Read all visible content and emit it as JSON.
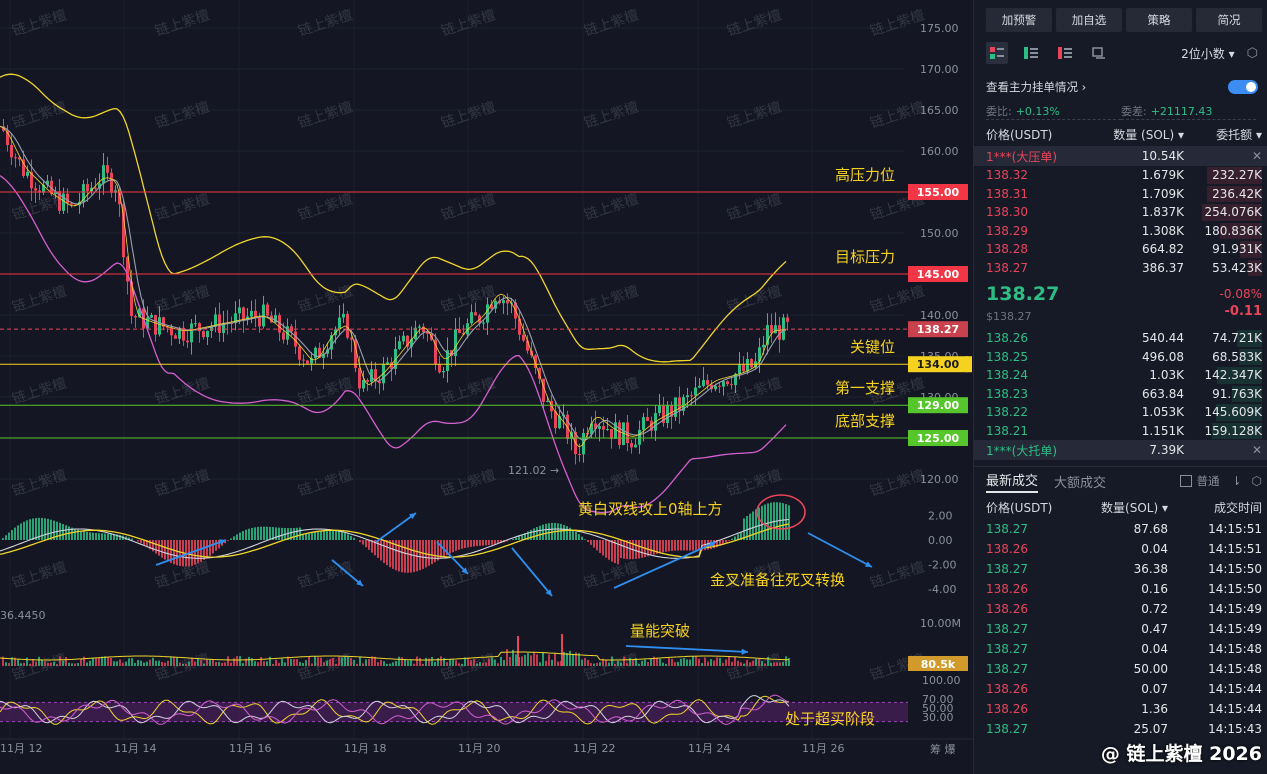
{
  "chart": {
    "price_axis": [
      "175.00",
      "170.00",
      "165.00",
      "160.00",
      "155.00",
      "150.00",
      "145.00",
      "140.00",
      "135.00",
      "130.00",
      "125.00",
      "120.00"
    ],
    "macd_axis": [
      "2.00",
      "0.00",
      "-2.00",
      "-4.00"
    ],
    "volume_axis": [
      "10.00M"
    ],
    "rsi_axis": [
      "100.00",
      "70.00",
      "50.00",
      "30.00"
    ],
    "date_axis": [
      "11月 12",
      "11月 14",
      "11月 16",
      "11月 18",
      "11月 20",
      "11月 22",
      "11月 24",
      "11月 26"
    ],
    "corner_right": "筹 爆",
    "levels": [
      {
        "label": "高压力位",
        "value": "155.00",
        "price": 155,
        "color": "#f23645",
        "text": "#ffffff"
      },
      {
        "label": "目标压力",
        "value": "145.00",
        "price": 145,
        "color": "#f23645",
        "text": "#ffffff"
      },
      {
        "label": "关键位",
        "value": "134.00",
        "price": 134,
        "color": "#f5d21f",
        "text": "#1a1a1a"
      },
      {
        "label": "第一支撑",
        "value": "129.00",
        "price": 129,
        "color": "#57c52c",
        "text": "#ffffff"
      },
      {
        "label": "底部支撑",
        "value": "125.00",
        "price": 125,
        "color": "#57c52c",
        "text": "#ffffff"
      }
    ],
    "current_price_tag": "138.27",
    "low_marker": "121.02 →",
    "macd_left_value": "36.4450",
    "volume_tag": "80.5k",
    "annotations": {
      "macd": "黄白双线攻上0轴上方",
      "cross": "金叉准备往死叉转换",
      "volume": "量能突破",
      "rsi": "处于超买阶段"
    },
    "watermark": "链上紫檀",
    "colors": {
      "up": "#2ebd85",
      "down": "#e8455a",
      "ma_yellow": "#f5d21f",
      "boll": "#d35fd0",
      "arrow": "#2f8ff0"
    }
  },
  "side": {
    "buttons": [
      "加预警",
      "加自选",
      "策略",
      "简况"
    ],
    "precision": "2位小数",
    "main_orders": "查看主力挂单情况",
    "ratio_label": "委比:",
    "ratio_value": "+0.13%",
    "diff_label": "委差:",
    "diff_value": "+21117.43",
    "ob_headers": [
      "价格(USDT)",
      "数量 (SOL)",
      "委托额"
    ],
    "big_ask": {
      "label": "1***(大压单)",
      "qty": "10.54K"
    },
    "asks": [
      {
        "p": "138.32",
        "q": "1.679K",
        "a": "232.27K",
        "d": 0.55
      },
      {
        "p": "138.31",
        "q": "1.709K",
        "a": "236.42K",
        "d": 0.55
      },
      {
        "p": "138.30",
        "q": "1.837K",
        "a": "254.076K",
        "d": 0.6
      },
      {
        "p": "138.29",
        "q": "1.308K",
        "a": "180.836K",
        "d": 0.42
      },
      {
        "p": "138.28",
        "q": "664.82",
        "a": "91.931K",
        "d": 0.22
      },
      {
        "p": "138.27",
        "q": "386.37",
        "a": "53.423K",
        "d": 0.14
      }
    ],
    "last_price": "138.27",
    "last_sub": "$138.27",
    "change_pct": "-0.08%",
    "change_abs": "-0.11",
    "bids": [
      {
        "p": "138.26",
        "q": "540.44",
        "a": "74.721K",
        "d": 0.25
      },
      {
        "p": "138.25",
        "q": "496.08",
        "a": "68.583K",
        "d": 0.23
      },
      {
        "p": "138.24",
        "q": "1.03K",
        "a": "142.347K",
        "d": 0.45
      },
      {
        "p": "138.23",
        "q": "663.84",
        "a": "91.763K",
        "d": 0.3
      },
      {
        "p": "138.22",
        "q": "1.053K",
        "a": "145.609K",
        "d": 0.46
      },
      {
        "p": "138.21",
        "q": "1.151K",
        "a": "159.128K",
        "d": 0.5
      }
    ],
    "big_bid": {
      "label": "1***(大托单)",
      "qty": "7.39K"
    },
    "trade_tabs": [
      "最新成交",
      "大额成交"
    ],
    "normal_label": "普通",
    "trade_headers": [
      "价格(USDT)",
      "数量(SOL)",
      "成交时间"
    ],
    "trades": [
      {
        "p": "138.27",
        "q": "87.68",
        "t": "14:15:51",
        "s": "up"
      },
      {
        "p": "138.26",
        "q": "0.04",
        "t": "14:15:51",
        "s": "down"
      },
      {
        "p": "138.27",
        "q": "36.38",
        "t": "14:15:50",
        "s": "up"
      },
      {
        "p": "138.26",
        "q": "0.16",
        "t": "14:15:50",
        "s": "down"
      },
      {
        "p": "138.26",
        "q": "0.72",
        "t": "14:15:49",
        "s": "down"
      },
      {
        "p": "138.27",
        "q": "0.47",
        "t": "14:15:49",
        "s": "up"
      },
      {
        "p": "138.27",
        "q": "0.04",
        "t": "14:15:48",
        "s": "up"
      },
      {
        "p": "138.27",
        "q": "50.00",
        "t": "14:15:48",
        "s": "up"
      },
      {
        "p": "138.26",
        "q": "0.07",
        "t": "14:15:44",
        "s": "down"
      },
      {
        "p": "138.26",
        "q": "1.36",
        "t": "14:15:44",
        "s": "down"
      },
      {
        "p": "138.27",
        "q": "25.07",
        "t": "14:15:43",
        "s": "up"
      }
    ],
    "brand": "@ 链上紫檀 2026"
  }
}
